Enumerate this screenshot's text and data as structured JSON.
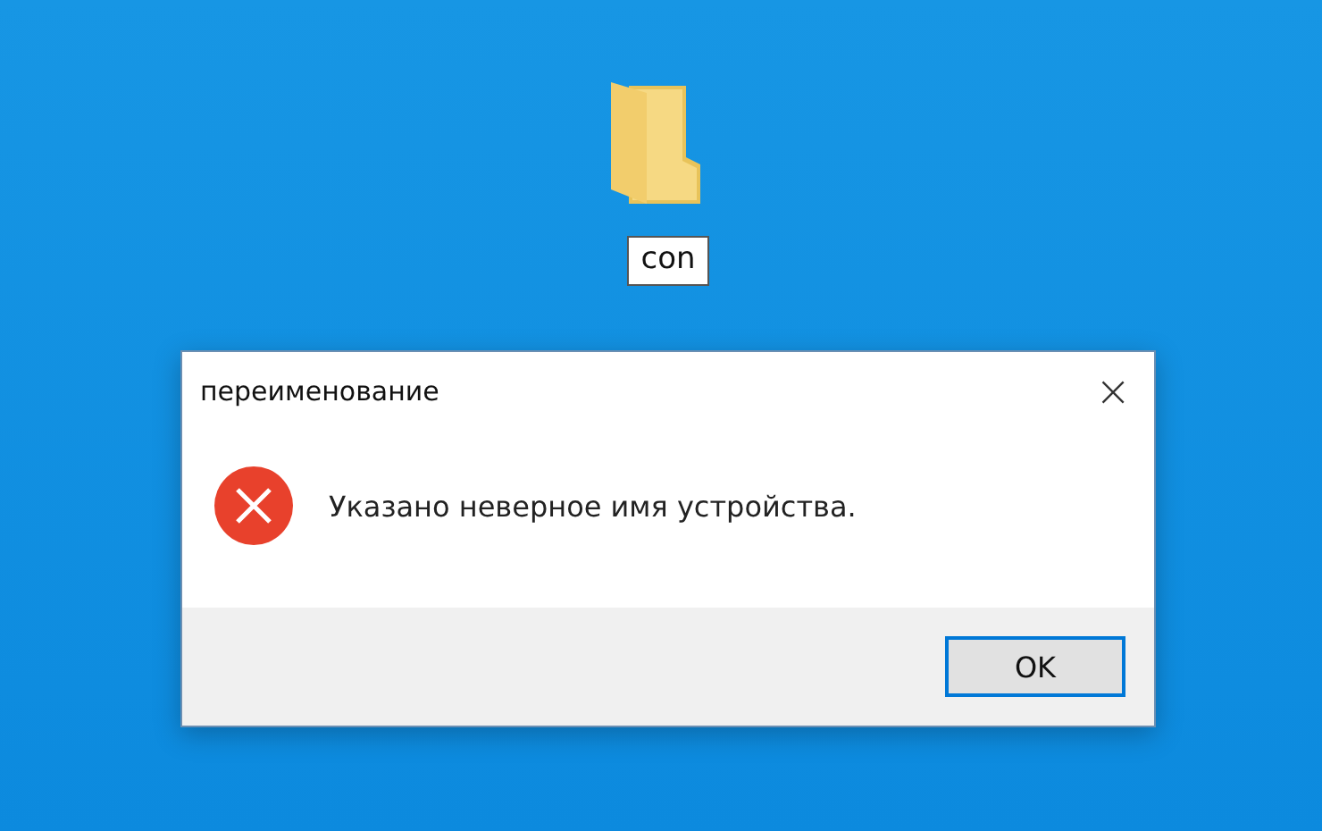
{
  "desktop": {
    "icon": {
      "label": "con",
      "editing": true
    }
  },
  "dialog": {
    "title": "переименование",
    "close": "×",
    "message": "Указано неверное имя устройства.",
    "buttons": [
      {
        "label": "OK",
        "focused": true
      }
    ]
  }
}
